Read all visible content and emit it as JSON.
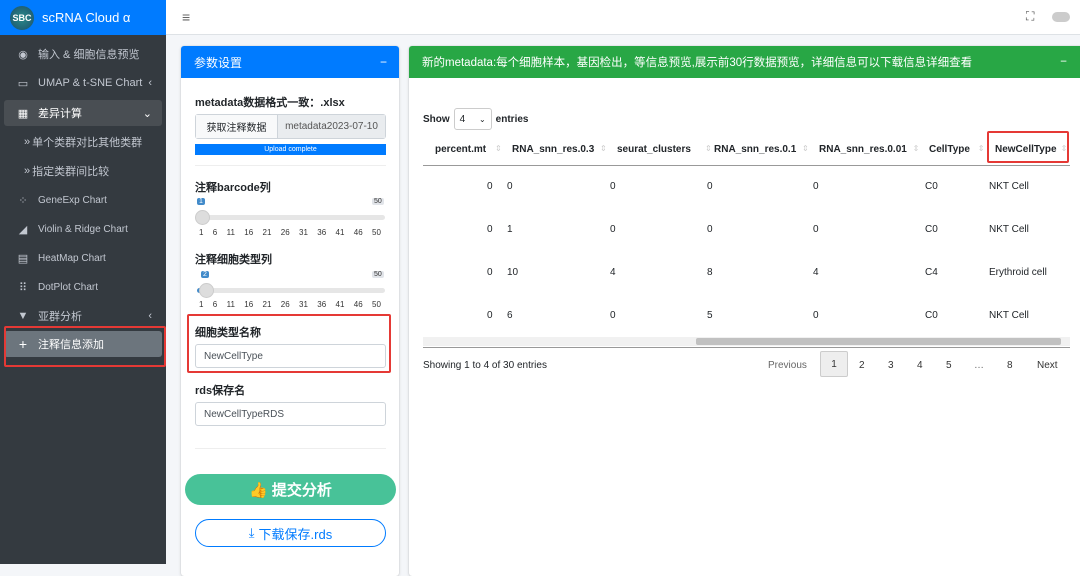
{
  "brand": {
    "logo": "SBC",
    "title": "scRNA Cloud α"
  },
  "sidebar": {
    "items": [
      {
        "label": "输入 & 细胞信息预览",
        "icon": "eye-icon"
      },
      {
        "label": "UMAP & t-SNE Chart",
        "icon": "monitor-icon"
      },
      {
        "label": "差异计算",
        "icon": "calculator-icon"
      },
      {
        "label": "单个类群对比其他类群",
        "icon": "double-chevron-icon"
      },
      {
        "label": "指定类群间比较",
        "icon": "double-chevron-icon"
      },
      {
        "label": "GeneExp Chart",
        "icon": "spinner-icon"
      },
      {
        "label": "Violin & Ridge Chart",
        "icon": "area-chart-icon"
      },
      {
        "label": "HeatMap Chart",
        "icon": "table-icon"
      },
      {
        "label": "DotPlot Chart",
        "icon": "grid-icon"
      },
      {
        "label": "亚群分析",
        "icon": "filter-icon"
      },
      {
        "label": "注释信息添加",
        "icon": "plus-icon"
      }
    ]
  },
  "params": {
    "title": "参数设置",
    "collapse": "−",
    "metadata_label": "metadata数据格式一致：.xlsx",
    "browse_button": "获取注释数据",
    "file_name": "metadata2023-07-10",
    "upload_status": "Upload complete",
    "upload_progress": 100,
    "barcode_label": "注释barcode列",
    "barcode_value": "1",
    "barcode_max": "50",
    "celltype_label": "注释细胞类型列",
    "celltype_value": "2",
    "celltype_max": "50",
    "ticks": [
      "1",
      "6",
      "11",
      "16",
      "21",
      "26",
      "31",
      "36",
      "41",
      "46",
      "50"
    ],
    "name_label": "细胞类型名称",
    "name_value": "NewCellType",
    "rds_label": "rds保存名",
    "rds_value": "NewCellTypeRDS",
    "submit_button": "提交分析",
    "download_button": "下载保存.rds"
  },
  "preview": {
    "title": "新的metadata:每个细胞样本，基因检出，等信息预览,展示前30行数据预览，详细信息可以下载信息详细查看",
    "collapse": "−",
    "show": "Show",
    "entries_value": "4",
    "entries": "entries",
    "columns": [
      "percent.mt",
      "RNA_snn_res.0.3",
      "seurat_clusters",
      "RNA_snn_res.0.1",
      "RNA_snn_res.0.01",
      "CellType",
      "NewCellType"
    ],
    "rows": [
      [
        "0",
        "0",
        "0",
        "0",
        "0",
        "C0",
        "NKT Cell"
      ],
      [
        "0",
        "1",
        "0",
        "0",
        "0",
        "C0",
        "NKT Cell"
      ],
      [
        "0",
        "10",
        "4",
        "8",
        "4",
        "C4",
        "Erythroid cell"
      ],
      [
        "0",
        "6",
        "0",
        "5",
        "0",
        "C0",
        "NKT Cell"
      ]
    ],
    "info": "Showing 1 to 4 of 30 entries",
    "pagination": [
      "Previous",
      "1",
      "2",
      "3",
      "4",
      "5",
      "…",
      "8",
      "Next"
    ]
  }
}
